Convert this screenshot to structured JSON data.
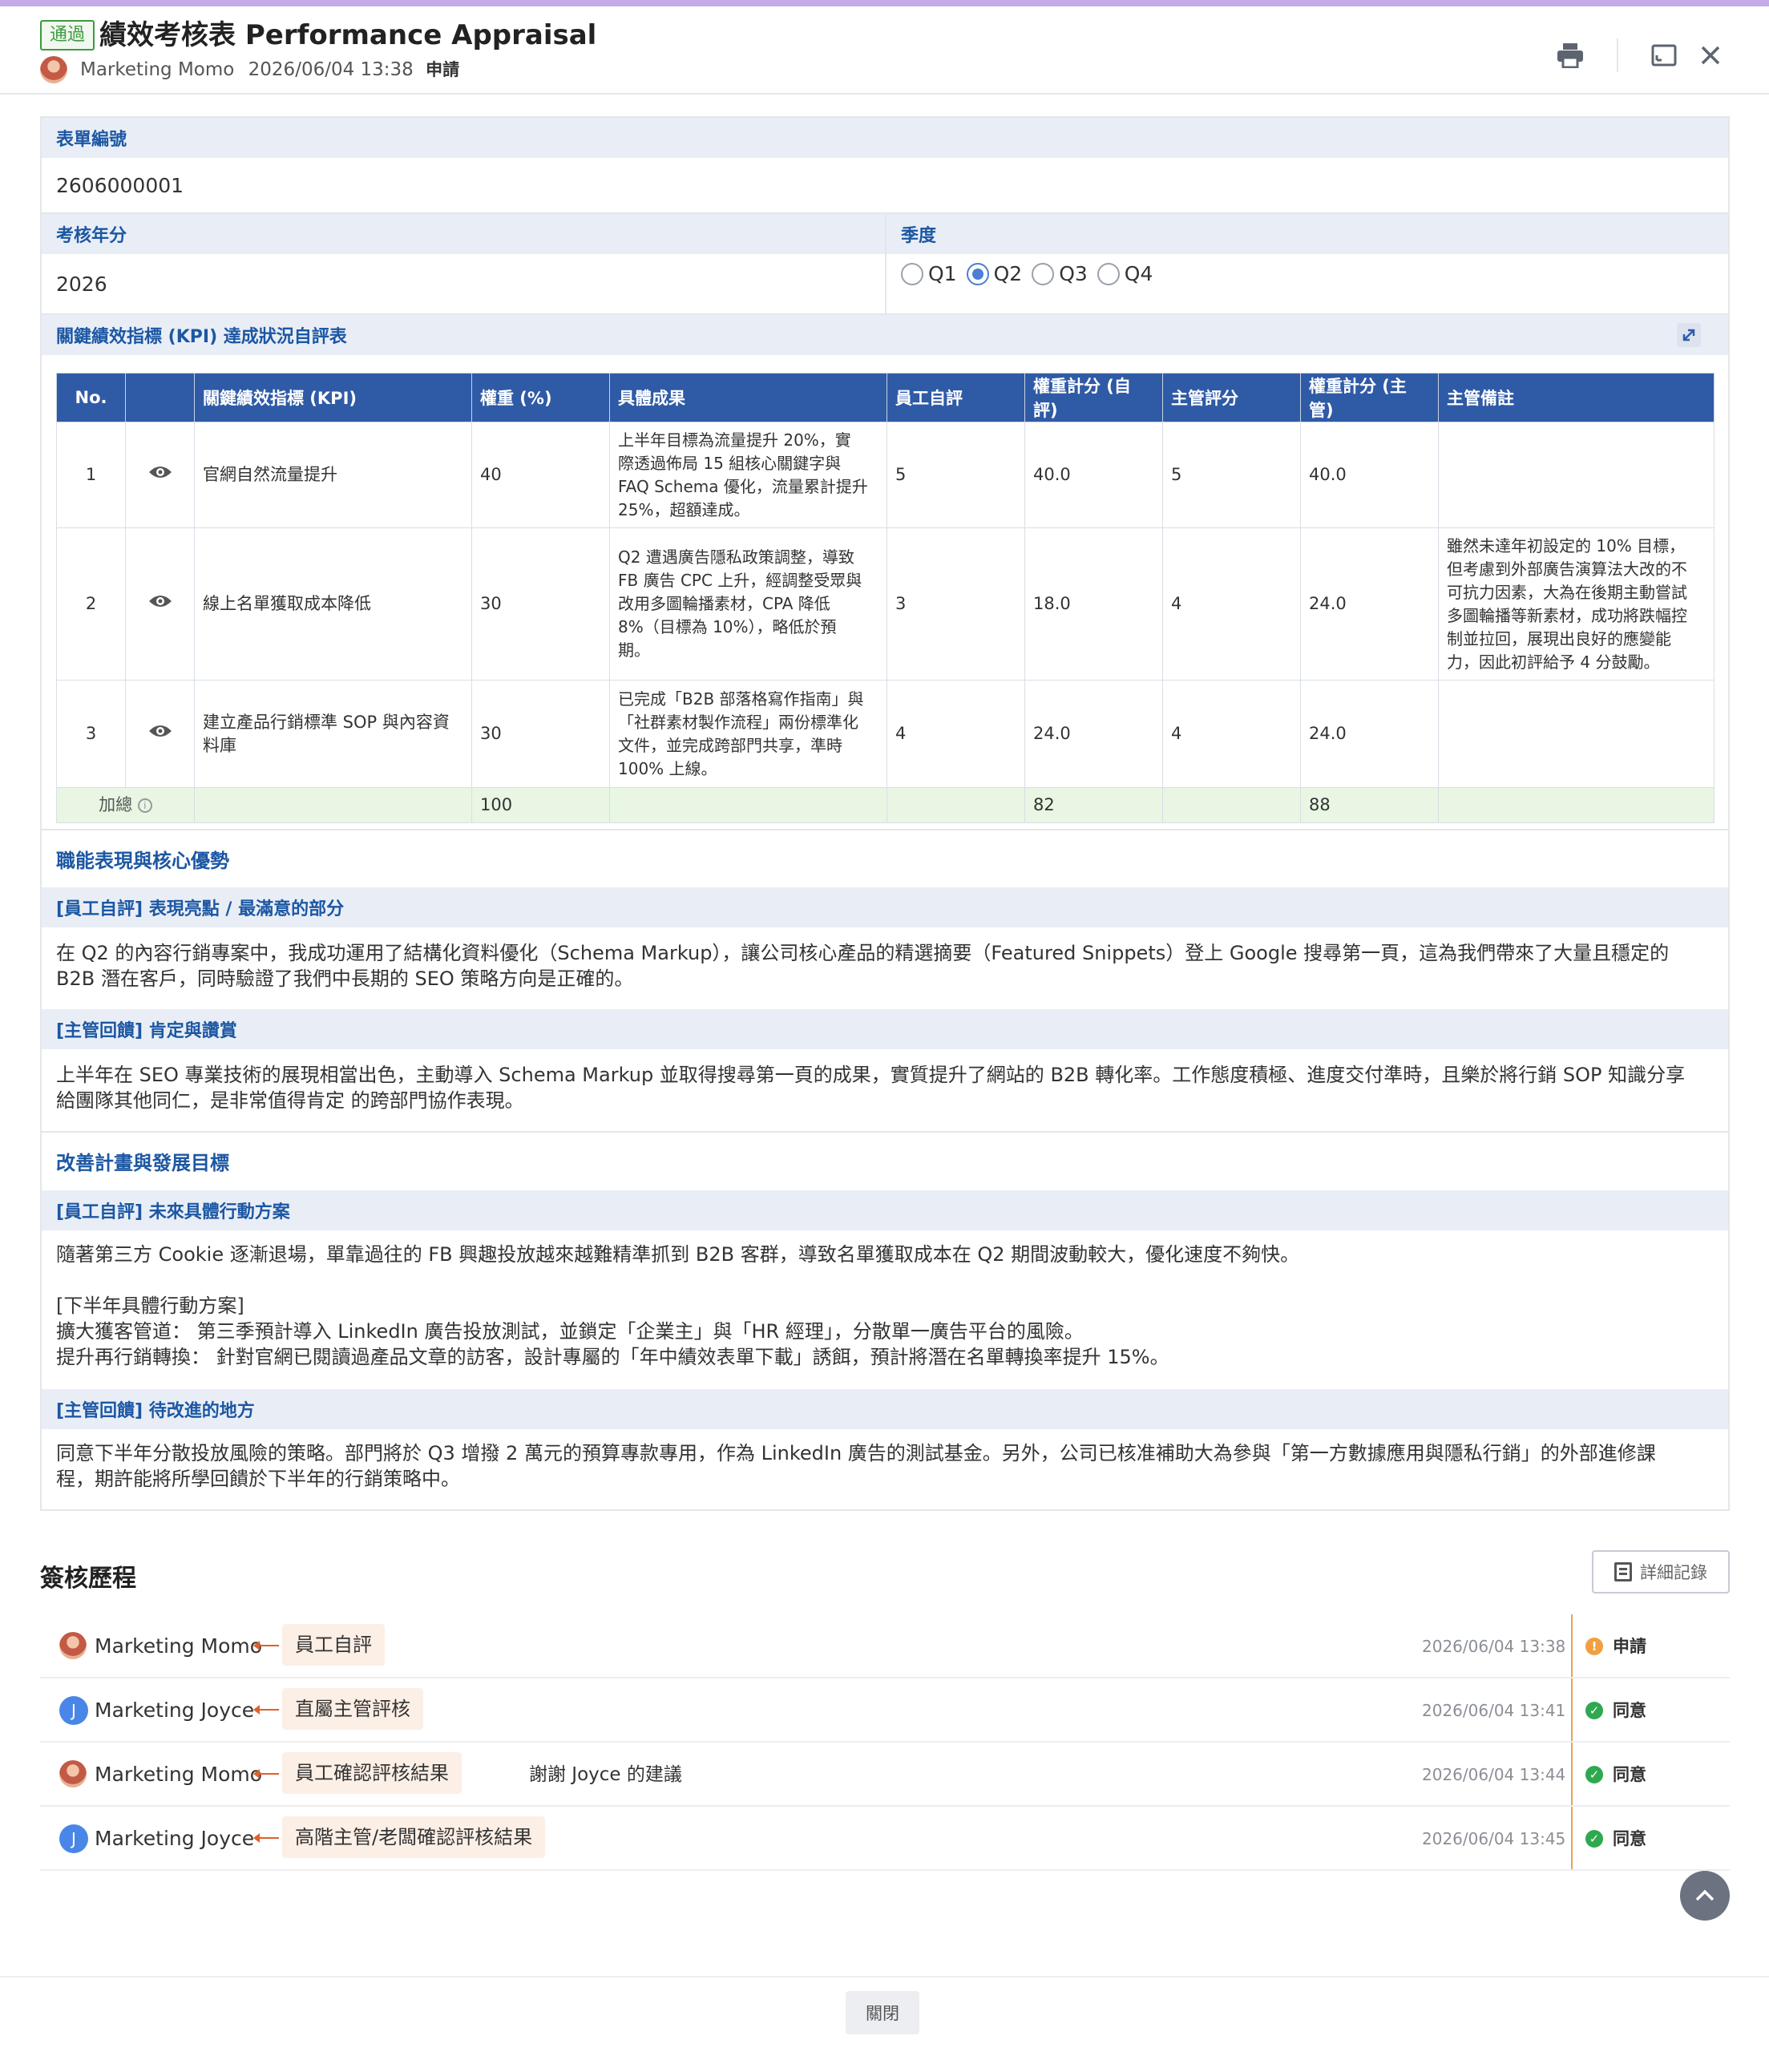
{
  "header": {
    "status_tag": "通過",
    "title": "績效考核表 Performance Appraisal",
    "applicant": "Marketing Momo",
    "datetime": "2026/06/04 13:38",
    "action": "申請"
  },
  "form": {
    "form_no_label": "表單編號",
    "form_no": "2606000001",
    "year_label": "考核年分",
    "year": "2026",
    "quarter_label": "季度",
    "quarters": [
      "Q1",
      "Q2",
      "Q3",
      "Q4"
    ],
    "quarter_selected": "Q2",
    "kpi_section_title": "關鍵績效指標 (KPI) 達成狀況自評表",
    "kpi_headers": [
      "No.",
      "",
      "關鍵績效指標 (KPI)",
      "權重 (%)",
      "具體成果",
      "員工自評",
      "權重計分 (自評)",
      "主管評分",
      "權重計分 (主管)",
      "主管備註"
    ],
    "kpi_rows": [
      {
        "no": "1",
        "kpi": "官網自然流量提升",
        "weight": "40",
        "result": [
          "上半年目標為流量提升 20%，實",
          "際透過佈局 15 組核心關鍵字與",
          "FAQ Schema 優化，流量累計提升",
          "25%，超額達成。"
        ],
        "self_score": "5",
        "self_weighted": "40.0",
        "mgr_score": "5",
        "mgr_weighted": "40.0",
        "mgr_note": []
      },
      {
        "no": "2",
        "kpi": "線上名單獲取成本降低",
        "weight": "30",
        "result": [
          "Q2 遭遇廣告隱私政策調整，導致",
          "FB 廣告 CPC 上升，經調整受眾與",
          "改用多圖輪播素材，CPA 降低",
          "8%（目標為 10%），略低於預",
          "期。"
        ],
        "self_score": "3",
        "self_weighted": "18.0",
        "mgr_score": "4",
        "mgr_weighted": "24.0",
        "mgr_note": [
          "雖然未達年初設定的 10% 目標，",
          "但考慮到外部廣告演算法大改的不",
          "可抗力因素，大為在後期主動嘗試",
          "多圖輪播等新素材，成功將跌幅控",
          "制並拉回，展現出良好的應變能",
          "力，因此初評給予 4 分鼓勵。"
        ]
      },
      {
        "no": "3",
        "kpi": [
          "建立產品行銷標準 SOP 與內容資",
          "料庫"
        ],
        "weight": "30",
        "result": [
          "已完成「B2B 部落格寫作指南」與",
          "「社群素材製作流程」兩份標準化",
          "文件，並完成跨部門共享，準時",
          "100% 上線。"
        ],
        "self_score": "4",
        "self_weighted": "24.0",
        "mgr_score": "4",
        "mgr_weighted": "24.0",
        "mgr_note": []
      }
    ],
    "kpi_total": {
      "label": "加總",
      "weight": "100",
      "self_weighted": "82",
      "mgr_weighted": "88"
    },
    "competency_title": "職能表現與核心優勢",
    "self_highlight_label": "[員工自評] 表現亮點 / 最滿意的部分",
    "self_highlight": [
      "在 Q2 的內容行銷專案中，我成功運用了結構化資料優化（Schema Markup），讓公司核心產品的精選摘要（Featured Snippets）登上 Google 搜尋第一頁，這為我們帶來了大量且穩定的",
      "B2B 潛在客戶，同時驗證了我們中長期的 SEO 策略方向是正確的。"
    ],
    "mgr_praise_label": "[主管回饋] 肯定與讚賞",
    "mgr_praise": [
      "上半年在 SEO 專業技術的展現相當出色，主動導入 Schema Markup 並取得搜尋第一頁的成果，實質提升了網站的 B2B 轉化率。工作態度積極、進度交付準時，且樂於將行銷 SOP 知識分享",
      "給團隊其他同仁，是非常值得肯定 的跨部門協作表現。"
    ],
    "improve_title": "改善計畫與發展目標",
    "self_plan_label": "[員工自評] 未來具體行動方案",
    "self_plan": [
      "隨著第三方 Cookie 逐漸退場，單靠過往的 FB 興趣投放越來越難精準抓到 B2B 客群，導致名單獲取成本在 Q2 期間波動較大，優化速度不夠快。",
      "",
      "[下半年具體行動方案]",
      "擴大獲客管道： 第三季預計導入 LinkedIn 廣告投放測試，並鎖定「企業主」與「HR 經理」，分散單一廣告平台的風險。",
      "提升再行銷轉換： 針對官網已閱讀過產品文章的訪客，設計專屬的「年中績效表單下載」誘餌，預計將潛在名單轉換率提升 15%。"
    ],
    "mgr_improve_label": "[主管回饋] 待改進的地方",
    "mgr_improve": [
      "同意下半年分散投放風險的策略。部門將於 Q3 增撥 2 萬元的預算專款專用，作為 LinkedIn 廣告的測試基金。另外，公司已核准補助大為參與「第一方數據應用與隱私行銷」的外部進修課",
      "程，期許能將所學回饋於下半年的行銷策略中。"
    ]
  },
  "history": {
    "title": "簽核歷程",
    "detail_button": "詳細記錄",
    "rows": [
      {
        "avatar": "momo",
        "name": "Marketing Momo",
        "step": "員工自評",
        "comment": "",
        "time": "2026/06/04 13:38",
        "result": "申請",
        "result_color": "#f0a040",
        "result_icon": "!"
      },
      {
        "avatar": "J",
        "name": "Marketing Joyce",
        "step": "直屬主管評核",
        "comment": "",
        "time": "2026/06/04 13:41",
        "result": "同意",
        "result_color": "#2fa84f",
        "result_icon": "✓"
      },
      {
        "avatar": "momo",
        "name": "Marketing Momo",
        "step": "員工確認評核結果",
        "comment": "謝謝 Joyce 的建議",
        "time": "2026/06/04 13:44",
        "result": "同意",
        "result_color": "#2fa84f",
        "result_icon": "✓"
      },
      {
        "avatar": "J",
        "name": "Marketing Joyce",
        "step": "高階主管/老闆確認評核結果",
        "comment": "",
        "time": "2026/06/04 13:45",
        "result": "同意",
        "result_color": "#2fa84f",
        "result_icon": "✓"
      }
    ]
  },
  "footer": {
    "close_button": "關閉"
  }
}
